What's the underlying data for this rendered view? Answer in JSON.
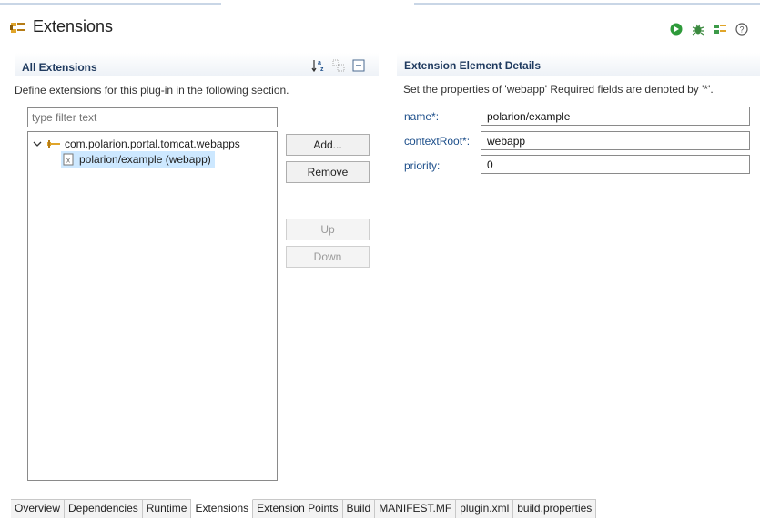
{
  "editor": {
    "title": "Extensions",
    "toolbar_icons": [
      "run-icon",
      "debug-icon",
      "extensions-icon",
      "help-icon"
    ]
  },
  "all_extensions": {
    "title": "All Extensions",
    "description": "Define extensions for this plug-in in the following section.",
    "filter_placeholder": "type filter text",
    "tree": [
      {
        "label": "com.polarion.portal.tomcat.webapps",
        "expanded": true
      },
      {
        "label": "polarion/example (webapp)",
        "selected": true
      }
    ],
    "buttons": {
      "add": "Add...",
      "remove": "Remove",
      "up": "Up",
      "down": "Down"
    }
  },
  "details": {
    "title": "Extension Element Details",
    "description": "Set the properties of 'webapp' Required fields are denoted by '*'.",
    "fields": [
      {
        "label": "name*:",
        "value": "polarion/example"
      },
      {
        "label": "contextRoot*:",
        "value": "webapp"
      },
      {
        "label": "priority:",
        "value": "0"
      }
    ]
  },
  "tabs": [
    {
      "label": "Overview"
    },
    {
      "label": "Dependencies"
    },
    {
      "label": "Runtime"
    },
    {
      "label": "Extensions",
      "active": true
    },
    {
      "label": "Extension Points"
    },
    {
      "label": "Build"
    },
    {
      "label": "MANIFEST.MF"
    },
    {
      "label": "plugin.xml"
    },
    {
      "label": "build.properties"
    }
  ],
  "colors": {
    "accent": "#1c4e8a",
    "selection": "#cde8ff",
    "run_green": "#2e9a3a"
  }
}
